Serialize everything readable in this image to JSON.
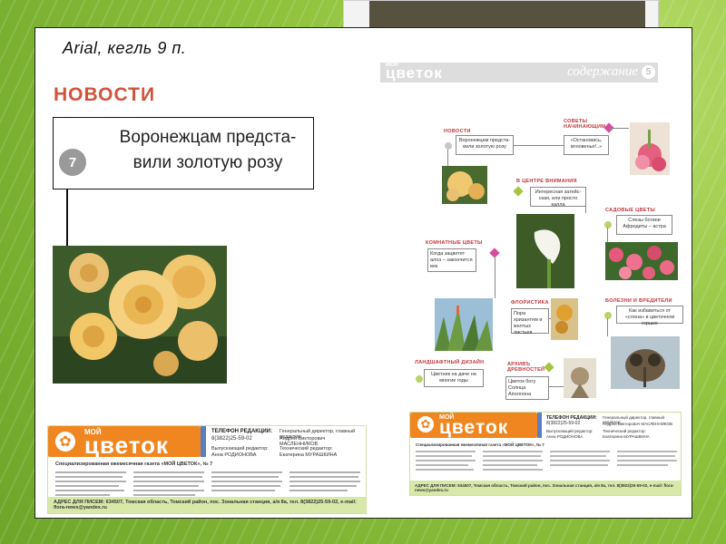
{
  "caption": "Arial, кегль 9 п.",
  "left_page": {
    "section": "НОВОСТИ",
    "headline": "Воронежцам предста-вили золотую розу",
    "headline_line1": "Воронежцам предста-",
    "headline_line2": "вили золотую розу",
    "number": "7"
  },
  "footer_left": {
    "brand_small": "МОЙ",
    "brand": "цветок",
    "tagline": "Специализированная ежемесячная газета «МОЙ ЦВЕТОК», № 7",
    "phone_label": "ТЕЛЕФОН РЕДАКЦИИ:",
    "phone": "8(3822)25-59-02",
    "release_label": "Выпускающий редактор:",
    "release_name": "Анна РОДИОНОВА",
    "gen_director_label": "Генеральный директор, главный редактор:",
    "gen_director_name": "Андрей Викторович МАСЛЕННИКОВ",
    "tech_editor_label": "Технический редактор:",
    "tech_editor_name": "Екатерина МУРАШКИНА",
    "address": "АДРЕС ДЛЯ ПИСЕМ: 634507, Томская область, Томский район, пос. Зональная станция, а/я 8а, тел. 8(3822)25-59-02, e-mail: flora-news@yandex.ru"
  },
  "right_page": {
    "brand_small": "МОЙ",
    "brand": "цветок",
    "contents": "содержание",
    "page_number": "5",
    "sections": {
      "news": "НОВОСТИ",
      "news_item": "Воронежцам предста-вили золотую розу",
      "tips": "СОВЕТЫ НАЧИНАЮЩИМ",
      "tips_item": "«Остановись, мгновенье!..»",
      "focus": "В ЦЕНТРЕ ВНИМАНИЯ",
      "focus_item": "Интересная затейс-ская, или просто калла",
      "garden": "САДОВЫЕ ЦВЕТЫ",
      "garden_item": "Слезы богини Афродиты – астра",
      "indoor": "КОМНАТНЫЕ ЦВЕТЫ",
      "indoor_item": "Когда зацветет алоэ – закончится век",
      "floristics": "ФЛОРИСТИКА",
      "floristics_item": "Пора хризантем и желтых листьев",
      "diseases": "БОЛЕЗНИ И ВРЕДИТЕЛИ",
      "diseases_item": "Как избавиться от «слона» в цветочном горшке",
      "landscape": "ЛАНДШАФТНЫЙ ДИЗАЙН",
      "landscape_item": "Цветник на даче на многие годы",
      "archive": "АРХИВЪ ДРЕВНОСТЕЙ",
      "archive_item": "Цветок богу Солнца Аполлона"
    }
  },
  "colors": {
    "background": "#8fc23c",
    "accent_red": "#d2533c",
    "brand_orange": "#f0861f",
    "brand_blue": "#5a7fc0"
  }
}
